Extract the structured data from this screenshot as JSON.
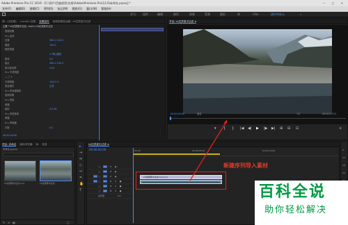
{
  "window": {
    "title": "Adobe Premiere Pro CC 2019 - [C:\\用户\\百度经验\\文档\\Adobe\\Premiere Pro\\13.0\\未命名.prproj] *",
    "controls": "— ▢ ✕"
  },
  "menu": [
    "文件(F)",
    "编辑(E)",
    "剪辑(C)",
    "序列(S)",
    "标记(M)",
    "图形(G)",
    "窗口(W)",
    "帮助(H)"
  ],
  "workspaces": [
    "学习",
    "组件",
    "编辑",
    "颜色",
    "效果",
    "音频",
    "图形",
    "库",
    "Vilio",
    "进行中办公"
  ],
  "active_workspace_index": 9,
  "effect_controls": {
    "tabs": [
      "源：(无剪辑)",
      "Lumetri 范围",
      "效果控件",
      "音频剪辑混合器：kk拉宾夏中过滤"
    ],
    "active_tab": 2,
    "header": "主要 * kk拉宾夏中过滤...mp4 ▸ kk拉宾夏中过滤",
    "rows": [
      {
        "label": "视频效果",
        "value": ""
      },
      {
        "label": "fx ▸ 运动",
        "value": ""
      },
      {
        "label": "  位置",
        "value": "960.0    540.0"
      },
      {
        "label": "  缩放",
        "value": "100.0"
      },
      {
        "label": "  缩放宽度",
        "value": ""
      },
      {
        "label": "",
        "value": "☑ 等比缩放"
      },
      {
        "label": "  旋转",
        "value": "0.0"
      },
      {
        "label": "  锚点",
        "value": "960.0    540.0"
      },
      {
        "label": "  防闪烁滤镜",
        "value": "0.00"
      },
      {
        "label": "fx ▸ 不透明度",
        "value": ""
      },
      {
        "label": "  ○ □ ✎",
        "value": ""
      },
      {
        "label": "  不透明度",
        "value": "100.0 %"
      },
      {
        "label": "  混合模式",
        "value": "正常"
      },
      {
        "label": "fx ▸ 时间重映射",
        "value": ""
      },
      {
        "label": "音频效果",
        "value": ""
      },
      {
        "label": "fx ▸ 音量",
        "value": ""
      },
      {
        "label": "  旁路",
        "value": ""
      },
      {
        "label": "  级别",
        "value": "0.0 dB"
      },
      {
        "label": "fx ▸ 声道音量",
        "value": ""
      },
      {
        "label": "  旁路",
        "value": ""
      },
      {
        "label": "fx ▸ 声像器",
        "value": ""
      },
      {
        "label": "  平衡",
        "value": "0.0"
      }
    ],
    "timecode": "00:00:00:00",
    "clip_name": "kk拉宾夏中过滤.mp4 - 剪辑"
  },
  "program_monitor": {
    "tab": "节目: kk拉宾夏中过滤 ≡",
    "timecode": "00:00:00:00",
    "fit": "适合",
    "quality": "1/2",
    "duration": "00:00:27:13",
    "transport": [
      "▾",
      "{",
      "}",
      "|◀",
      "◀|",
      "▶",
      "|▶",
      "▶|",
      "⊞",
      "⊟",
      "⊡",
      "+"
    ]
  },
  "project": {
    "tabs": [
      "项目: 未命名",
      "媒体浏览器",
      "库",
      "信息",
      "效果"
    ],
    "file": "未命名.prproj",
    "items": [
      {
        "name": "kk拉宾夏中过滤.mp4",
        "duration": "27:13"
      },
      {
        "name": "kk拉宾夏中过滤",
        "duration": "27:13"
      }
    ]
  },
  "timeline": {
    "tab": "kk拉宾夏中过滤 ≡",
    "timecode": "00:00:00:00",
    "ruler": [
      "00:00",
      "00:00:05:00",
      "00:00:10:00"
    ],
    "video_tracks": [
      "V3",
      "V2",
      "V1"
    ],
    "audio_tracks": [
      "A1",
      "A2",
      "A3"
    ],
    "master": "主声道",
    "master_value": "0.0",
    "clip_label": "kk拉宾夏中过滤.mp4 [V]",
    "levels": [
      "-6",
      "-12",
      "-18",
      "-24",
      "-30",
      "-36",
      "-42",
      "-48",
      "-54",
      "dB"
    ]
  },
  "annotation": {
    "text": "新建序列导入素材",
    "color": "#e0231e"
  },
  "watermark": {
    "title": "百科全说",
    "subtitle": "助你轻松解决",
    "color": "#009a43"
  }
}
